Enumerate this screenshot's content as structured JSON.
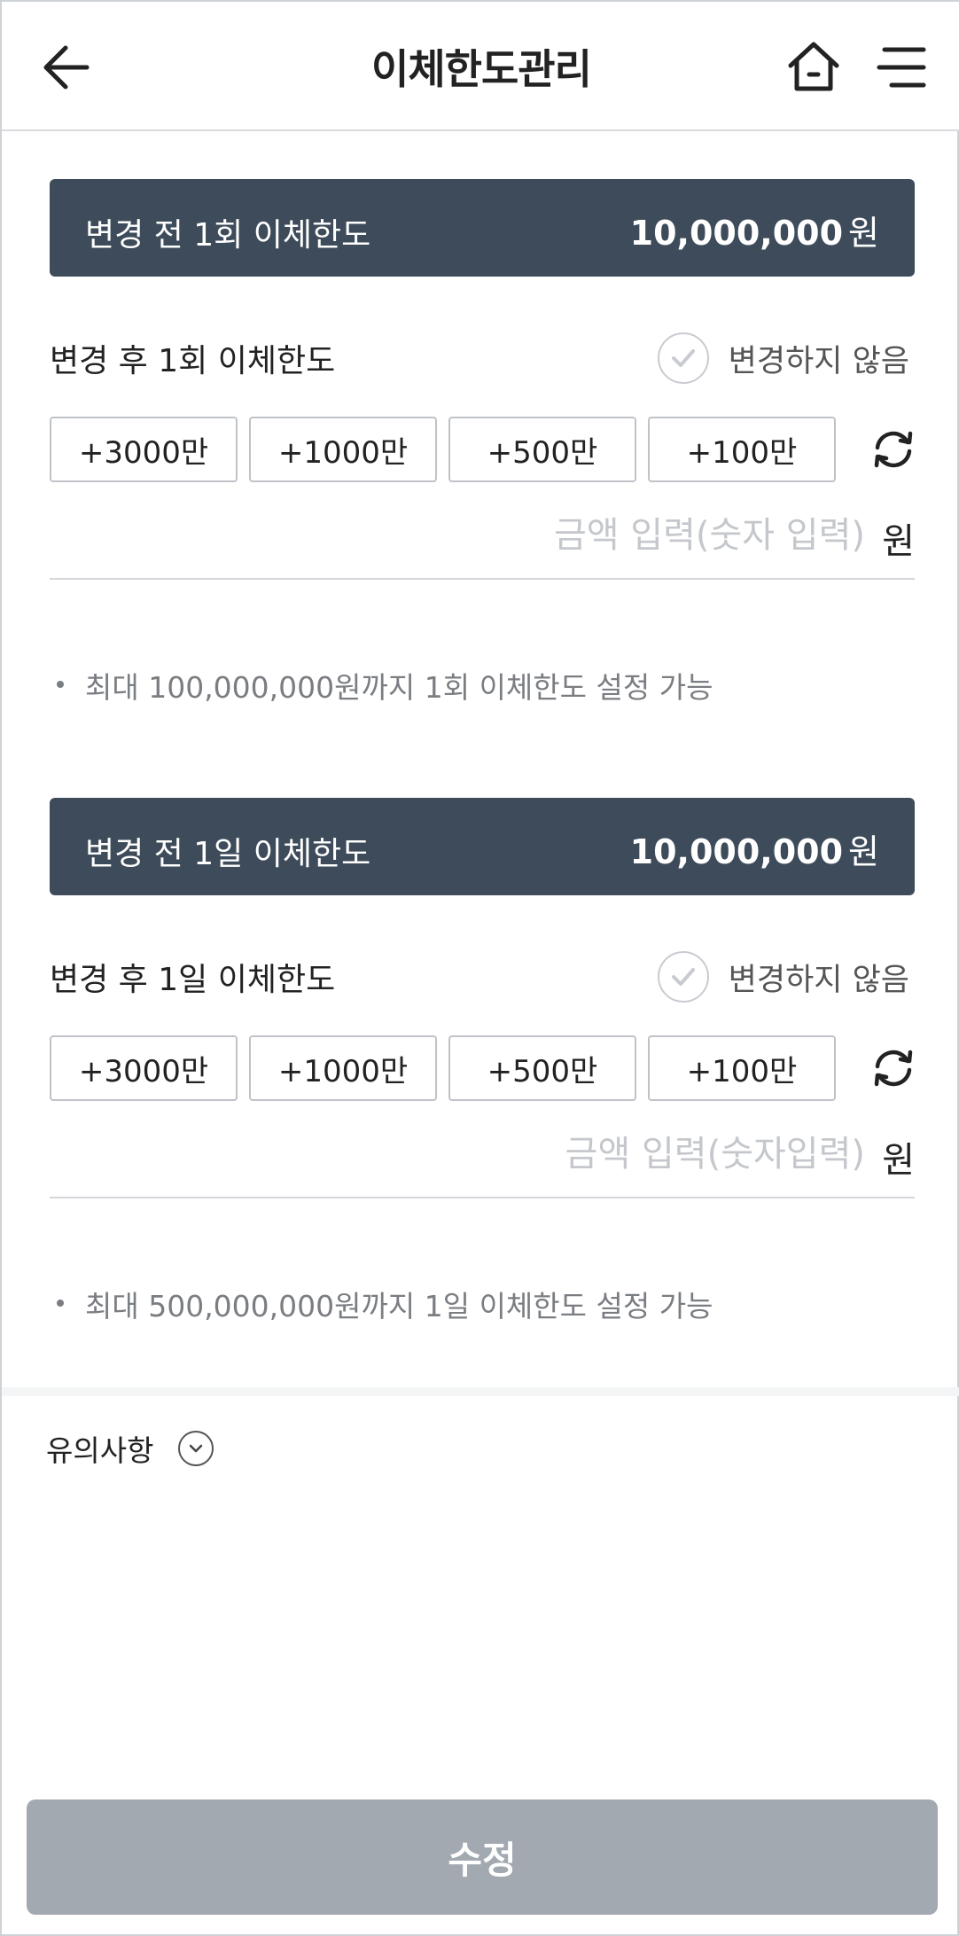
{
  "header": {
    "title": "이체한도관리"
  },
  "once": {
    "before_label": "변경 전 1회 이체한도",
    "before_amount": "10,000,000",
    "before_unit": "원",
    "after_label": "변경 후 1회 이체한도",
    "no_change_label": "변경하지 않음",
    "chips": [
      "+3000만",
      "+1000만",
      "+500만",
      "+100만"
    ],
    "amount_placeholder": "금액 입력(숫자 입력)",
    "amount_value": "",
    "amount_unit": "원",
    "note": "최대 100,000,000원까지 1회 이체한도 설정 가능"
  },
  "daily": {
    "before_label": "변경 전 1일 이체한도",
    "before_amount": "10,000,000",
    "before_unit": "원",
    "after_label": "변경 후 1일 이체한도",
    "no_change_label": "변경하지 않음",
    "chips": [
      "+3000만",
      "+1000만",
      "+500만",
      "+100만"
    ],
    "amount_placeholder": "금액 입력(숫자입력)",
    "amount_value": "",
    "amount_unit": "원",
    "note": "최대 500,000,000원까지 1일 이체한도 설정 가능"
  },
  "caution": {
    "label": "유의사항"
  },
  "submit": {
    "label": "수정"
  },
  "colors": {
    "banner_bg": "#3d4b5a",
    "submit_bg": "#a3a9b0",
    "placeholder": "#c4c7cb"
  },
  "icons": [
    "arrow-left-icon",
    "home-icon",
    "hamburger-menu-icon",
    "check-icon",
    "refresh-icon",
    "chevron-down-icon"
  ]
}
